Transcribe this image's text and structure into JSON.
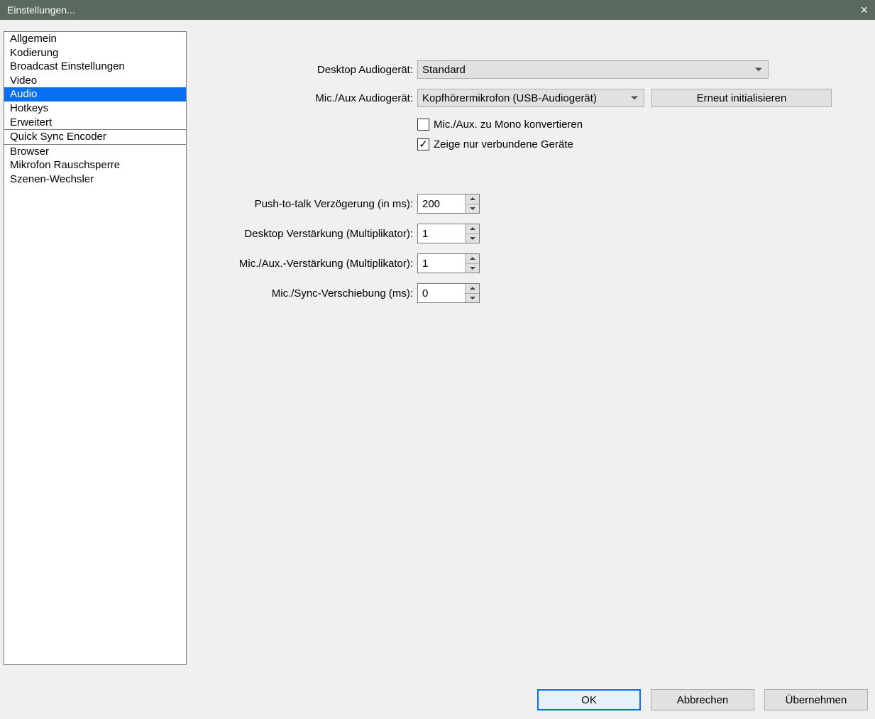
{
  "window": {
    "title": "Einstellungen..."
  },
  "sidebar": {
    "items": [
      "Allgemein",
      "Kodierung",
      "Broadcast Einstellungen",
      "Video",
      "Audio",
      "Hotkeys",
      "Erweitert",
      "Quick Sync Encoder",
      "Browser",
      "Mikrofon Rauschsperre",
      "Szenen-Wechsler"
    ],
    "selected_index": 4
  },
  "audio": {
    "desktop_label": "Desktop Audiogerät:",
    "desktop_value": "Standard",
    "mic_label": "Mic./Aux Audiogerät:",
    "mic_value": "Kopfhörermikrofon (USB-Audiogerät)",
    "reinit_button": "Erneut initialisieren",
    "mono_check_label": "Mic./Aux. zu Mono konvertieren",
    "mono_checked": false,
    "connected_check_label": "Zeige nur verbundene Geräte",
    "connected_checked": true,
    "ptt_label": "Push-to-talk Verzögerung (in ms):",
    "ptt_value": "200",
    "desktop_boost_label": "Desktop Verstärkung (Multiplikator):",
    "desktop_boost_value": "1",
    "mic_boost_label": "Mic./Aux.-Verstärkung (Multiplikator):",
    "mic_boost_value": "1",
    "mic_sync_label": "Mic./Sync-Verschiebung (ms):",
    "mic_sync_value": "0"
  },
  "buttons": {
    "ok": "OK",
    "cancel": "Abbrechen",
    "apply": "Übernehmen"
  }
}
